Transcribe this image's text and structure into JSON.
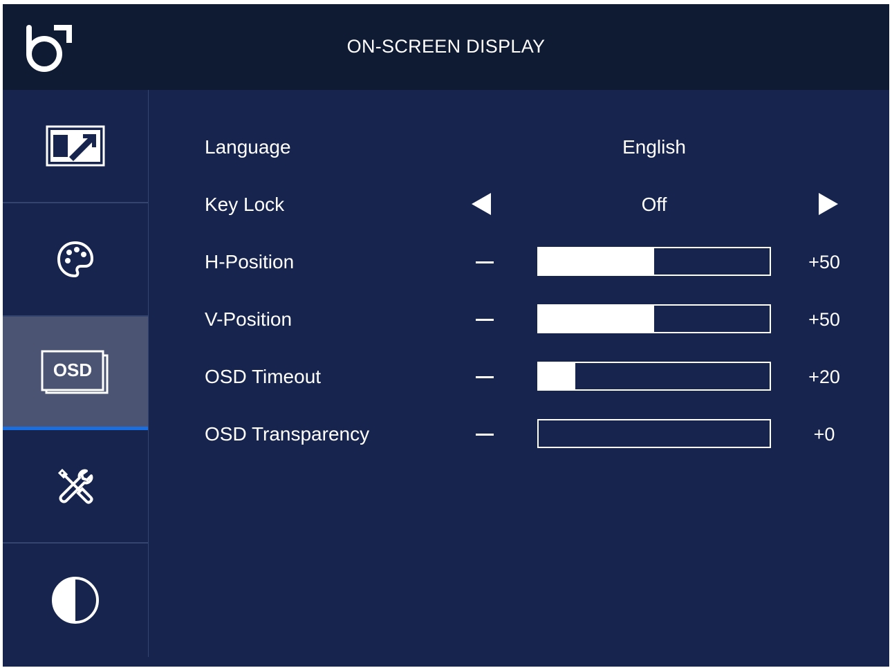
{
  "header": {
    "title": "ON-SCREEN DISPLAY",
    "logo_icon": "brand-logo-icon"
  },
  "sidebar": {
    "items": [
      {
        "id": "picture",
        "icon": "picture-adjust-icon",
        "active": false
      },
      {
        "id": "color",
        "icon": "palette-icon",
        "active": false
      },
      {
        "id": "osd",
        "icon": "osd-icon",
        "icon_text": "OSD",
        "active": true
      },
      {
        "id": "tools",
        "icon": "tools-icon",
        "active": false
      },
      {
        "id": "contrast",
        "icon": "contrast-icon",
        "active": false
      }
    ]
  },
  "settings": {
    "language": {
      "label": "Language",
      "value": "English"
    },
    "key_lock": {
      "label": "Key Lock",
      "value": "Off"
    },
    "h_position": {
      "label": "H-Position",
      "value": "+50",
      "level": 50
    },
    "v_position": {
      "label": "V-Position",
      "value": "+50",
      "level": 50
    },
    "osd_timeout": {
      "label": "OSD Timeout",
      "value": "+20",
      "level": 16
    },
    "osd_transparency": {
      "label": "OSD Transparency",
      "value": "+0",
      "level": 0
    }
  },
  "colors": {
    "background": "#17244d",
    "header": "#0f1a33",
    "active_tab": "#4b5573",
    "accent": "#1b6ee0",
    "foreground": "#ffffff"
  }
}
